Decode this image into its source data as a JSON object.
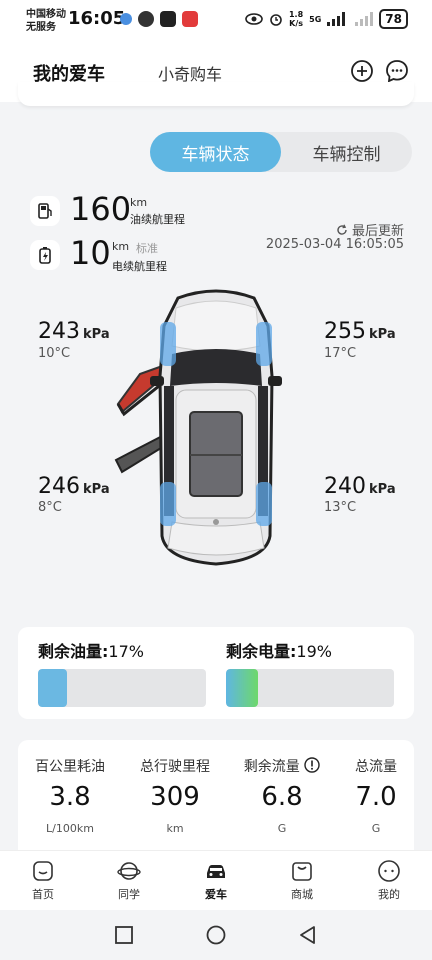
{
  "status_bar": {
    "carrier_line1": "中国移动",
    "carrier_line2": "无服务",
    "time": "16:05",
    "speed_value": "1.8",
    "speed_unit": "K/s",
    "network": "5G",
    "battery": "78"
  },
  "header": {
    "tab_active": "我的爱车",
    "tab_other": "小奇购车",
    "add_icon": "plus-circle-icon",
    "chat_icon": "chat-bubble-icon"
  },
  "segment": {
    "active": "车辆状态",
    "inactive": "车辆控制"
  },
  "range": {
    "fuel": {
      "value": "160",
      "unit": "km",
      "label": "油续航里程",
      "icon": "fuel-pump-icon"
    },
    "electric": {
      "value": "10",
      "unit": "km",
      "standard": "标准",
      "label": "电续航里程",
      "icon": "battery-icon"
    }
  },
  "update": {
    "label": "最后更新",
    "time": "2025-03-04 16:05:05"
  },
  "tires": {
    "front_left": {
      "pressure": "243",
      "unit": "kPa",
      "temp": "10°C"
    },
    "front_right": {
      "pressure": "255",
      "unit": "kPa",
      "temp": "17°C"
    },
    "rear_left": {
      "pressure": "246",
      "unit": "kPa",
      "temp": "8°C"
    },
    "rear_right": {
      "pressure": "240",
      "unit": "kPa",
      "temp": "13°C"
    }
  },
  "levels": {
    "fuel": {
      "label": "剩余油量:",
      "value": "17%",
      "fraction": 0.17,
      "color": "#6bb8e2"
    },
    "battery": {
      "label": "剩余电量:",
      "value": "19%",
      "fraction": 0.19,
      "color_start": "#5fb6e2",
      "color_end": "#6ed86a"
    }
  },
  "stats": [
    {
      "label": "百公里耗油",
      "value": "3.8",
      "unit": "L/100km"
    },
    {
      "label": "总行驶里程",
      "value": "309",
      "unit": "km"
    },
    {
      "label": "剩余流量",
      "value": "6.8",
      "unit": "G",
      "info_icon": "info-circle-icon"
    },
    {
      "label": "总流量",
      "value": "7.0",
      "unit": "G"
    }
  ],
  "nav": {
    "items": [
      {
        "label": "首页",
        "icon": "home-icon"
      },
      {
        "label": "同学",
        "icon": "planet-icon"
      },
      {
        "label": "爱车",
        "icon": "car-icon"
      },
      {
        "label": "商城",
        "icon": "shopping-bag-icon"
      },
      {
        "label": "我的",
        "icon": "profile-icon"
      }
    ]
  },
  "colors": {
    "accent": "#5fb6e2",
    "tab_underline": "#36b4b8"
  }
}
